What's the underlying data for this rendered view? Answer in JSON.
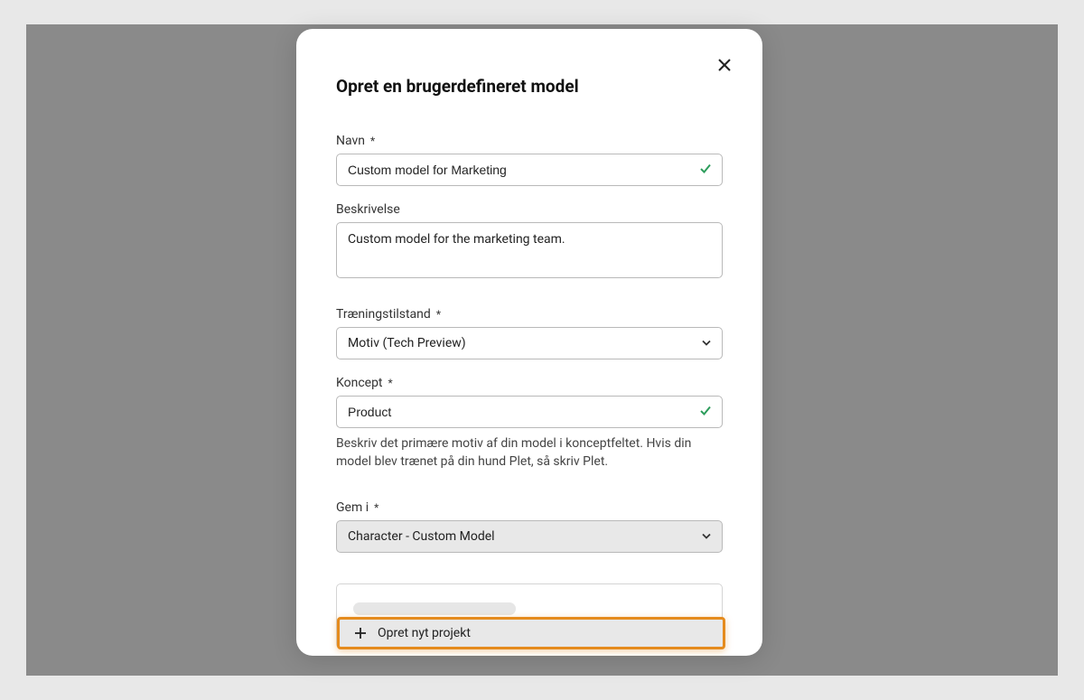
{
  "modal": {
    "title": "Opret en brugerdefineret model",
    "close_aria": "Close"
  },
  "fields": {
    "name": {
      "label": "Navn",
      "value": "Custom model for Marketing",
      "required": true
    },
    "description": {
      "label": "Beskrivelse",
      "value": "Custom model for the marketing team."
    },
    "training_mode": {
      "label": "Træningstilstand",
      "value": "Motiv (Tech Preview)",
      "required": true
    },
    "concept": {
      "label": "Koncept",
      "value": "Product",
      "required": true,
      "helper": "Beskriv det primære motiv af din model i konceptfeltet. Hvis din model blev trænet på din hund Plet, så skriv Plet."
    },
    "save_in": {
      "label": "Gem i",
      "value": "Character - Custom Model",
      "required": true
    }
  },
  "dropdown": {
    "create_project_label": "Opret nyt projekt"
  },
  "symbols": {
    "asterisk": "*"
  }
}
